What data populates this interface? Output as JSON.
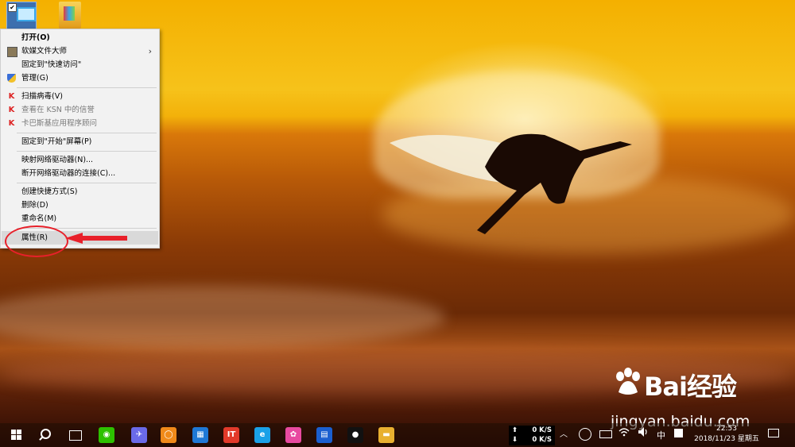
{
  "context_menu": {
    "items": [
      {
        "label": "打开(O)",
        "icon": null,
        "style": "bold"
      },
      {
        "label": "软媒文件大师",
        "icon": "softmedia-icon",
        "has_submenu": true
      },
      {
        "label": "固定到\"快速访问\"",
        "icon": null
      },
      {
        "label": "管理(G)",
        "icon": "uac-shield-icon"
      },
      {
        "label": "扫描病毒(V)",
        "icon": "kaspersky-icon"
      },
      {
        "label": "查看在 KSN 中的信誉",
        "icon": "kaspersky-icon",
        "style": "disabled"
      },
      {
        "label": "卡巴斯基应用程序顾问",
        "icon": "kaspersky-icon",
        "style": "disabled"
      },
      {
        "label": "固定到\"开始\"屏幕(P)",
        "icon": null
      },
      {
        "label": "映射网络驱动器(N)...",
        "icon": null
      },
      {
        "label": "断开网络驱动器的连接(C)...",
        "icon": null
      },
      {
        "label": "创建快捷方式(S)",
        "icon": null
      },
      {
        "label": "删除(D)",
        "icon": null
      },
      {
        "label": "重命名(M)",
        "icon": null
      },
      {
        "label": "属性(R)",
        "icon": null,
        "style": "highlighted"
      }
    ],
    "submenu_arrow": "›",
    "kaspersky_glyph": "K"
  },
  "desktop": {
    "icons": [
      {
        "name": "this-pc-icon",
        "checked": true,
        "check_glyph": "✔"
      },
      {
        "name": "image-file-icon"
      }
    ]
  },
  "annotation": {
    "highlight_color": "#e8202a"
  },
  "watermark": {
    "brand": "Bai",
    "brand_suffix": "经验",
    "url": "jingyan.baidu.com"
  },
  "taskbar": {
    "apps": [
      {
        "name": "wechat-icon",
        "glyph": "◉",
        "color": "#2dc100"
      },
      {
        "name": "feishu-icon",
        "glyph": "✈",
        "color": "#6a6ae8"
      },
      {
        "name": "browser-ring-icon",
        "glyph": "◯",
        "color": "#f08a1a"
      },
      {
        "name": "box-app-icon",
        "glyph": "▦",
        "color": "#1e78d6"
      },
      {
        "name": "wps-icon",
        "glyph": "IT",
        "color": "#e23a2a"
      },
      {
        "name": "ie-icon",
        "glyph": "e",
        "color": "#1aa1e8"
      },
      {
        "name": "color-wheel-icon",
        "glyph": "✿",
        "color": "#e84aa0"
      },
      {
        "name": "calendar-app-icon",
        "glyph": "▤",
        "color": "#1a5fd0"
      },
      {
        "name": "qq-icon",
        "glyph": "●",
        "color": "#111111"
      },
      {
        "name": "file-explorer-icon",
        "glyph": "▬",
        "color": "#e8b030"
      }
    ],
    "net_speed": {
      "up_arrow": "⬆",
      "down_arrow": "⬇",
      "up": "0 K/S",
      "down": "0 K/S"
    },
    "tray": {
      "chevron": "︿",
      "ime": "中",
      "icons": [
        "360-icon",
        "battery-icon",
        "wifi-icon",
        "speaker-icon",
        "input-user-icon"
      ]
    },
    "clock": {
      "time": "22:53",
      "date": "2018/11/23 星期五"
    }
  }
}
